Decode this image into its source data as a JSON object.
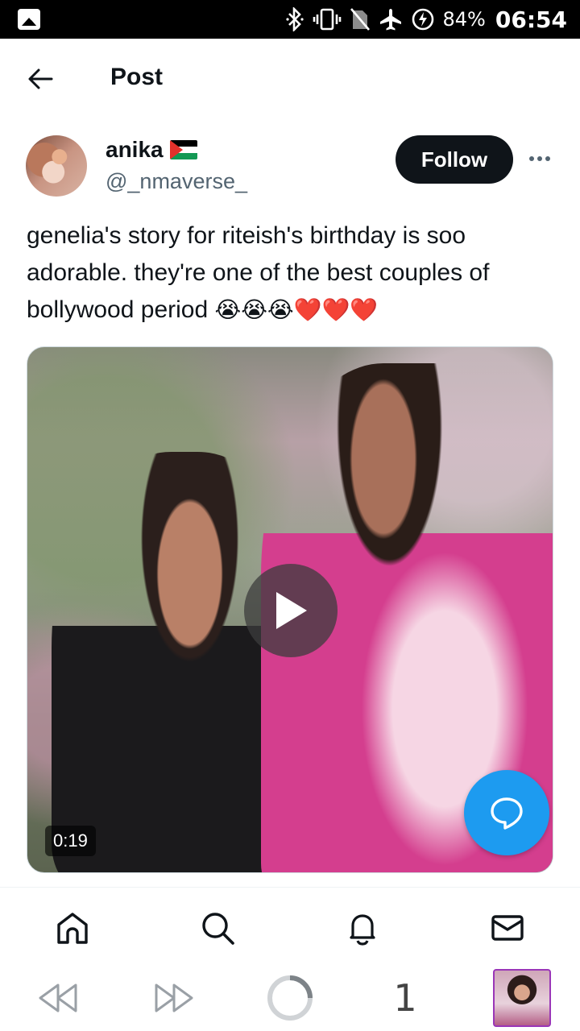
{
  "status_bar": {
    "battery_percent": "84%",
    "time": "06:54",
    "icons": [
      "gallery-icon",
      "bluetooth-icon",
      "vibrate-icon",
      "no-sim-icon",
      "airplane-icon",
      "battery-charging-icon"
    ]
  },
  "header": {
    "back_icon": "arrow-left-icon",
    "title": "Post"
  },
  "post": {
    "author": {
      "name": "anika",
      "flag": "palestine-flag",
      "handle": "@_nmaverse_",
      "follow_label": "Follow",
      "more_icon": "more-horizontal-icon"
    },
    "text": "genelia's story for riteish's birthday is soo adorable. they're one of the best couples of bollywood period ",
    "emojis": "😭😭😭❤️❤️❤️",
    "video": {
      "duration": "0:19",
      "play_icon": "play-icon"
    }
  },
  "fab": {
    "icon": "reply-bubble-icon",
    "color": "#1d9bf0"
  },
  "bottom_nav": {
    "items": [
      "home-icon",
      "search-icon",
      "notifications-icon",
      "messages-icon"
    ]
  },
  "browser_bar": {
    "back_icon": "rewind-icon",
    "forward_icon": "fast-forward-icon",
    "loading_icon": "loading-ring-icon",
    "tab_count": "1"
  },
  "colors": {
    "accent": "#1d9bf0",
    "text_primary": "#0f1419",
    "text_secondary": "#536471",
    "follow_bg": "#0f1419"
  }
}
